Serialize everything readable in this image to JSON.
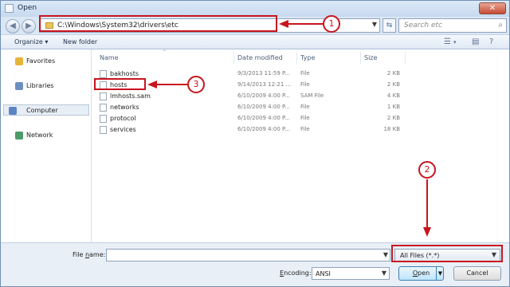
{
  "window": {
    "title": "Open",
    "close_label": "✕"
  },
  "nav": {
    "back_glyph": "◀",
    "forward_glyph": "▶",
    "address": "C:\\Windows\\System32\\drivers\\etc",
    "refresh_glyph": "⇆",
    "search_placeholder": "Search etc",
    "search_icon": "search-icon"
  },
  "toolbar": {
    "organize": "Organize ▾",
    "new_folder": "New folder",
    "view_icon": "view-icon",
    "pane_icon": "preview-pane-icon",
    "help_icon": "help-icon"
  },
  "sidebar": {
    "items": [
      {
        "label": "Favorites",
        "icon": "star-icon",
        "color": "#e5b43a"
      },
      {
        "label": "Libraries",
        "icon": "library-icon",
        "color": "#6d8fc0"
      },
      {
        "label": "Computer",
        "icon": "computer-icon",
        "color": "#5b84c4"
      },
      {
        "label": "Network",
        "icon": "network-icon",
        "color": "#4e9b6a"
      }
    ]
  },
  "columns": {
    "name": "Name",
    "date": "Date modified",
    "type": "Type",
    "size": "Size"
  },
  "files": [
    {
      "name": "bakhosts",
      "date": "9/3/2013 11:59 P...",
      "type": "File",
      "size": "2 KB"
    },
    {
      "name": "hosts",
      "date": "9/14/2013 12:21 ...",
      "type": "File",
      "size": "2 KB"
    },
    {
      "name": "lmhosts.sam",
      "date": "6/10/2009 4:00 P...",
      "type": "SAM File",
      "size": "4 KB"
    },
    {
      "name": "networks",
      "date": "6/10/2009 4:00 P...",
      "type": "File",
      "size": "1 KB"
    },
    {
      "name": "protocol",
      "date": "6/10/2009 4:00 P...",
      "type": "File",
      "size": "2 KB"
    },
    {
      "name": "services",
      "date": "6/10/2009 4:00 P...",
      "type": "File",
      "size": "18 KB"
    }
  ],
  "bottom": {
    "file_name_label_pre": "File ",
    "file_name_label_u": "n",
    "file_name_label_post": "ame:",
    "file_name_value": "",
    "filter": "All Files  (*.*)",
    "encoding_label_u": "E",
    "encoding_label_post": "ncoding:",
    "encoding": "ANSI",
    "open_u": "O",
    "open_post": "pen",
    "cancel": "Cancel"
  },
  "annotations": {
    "one": "1",
    "two": "2",
    "three": "3",
    "color": "#c8141e"
  }
}
